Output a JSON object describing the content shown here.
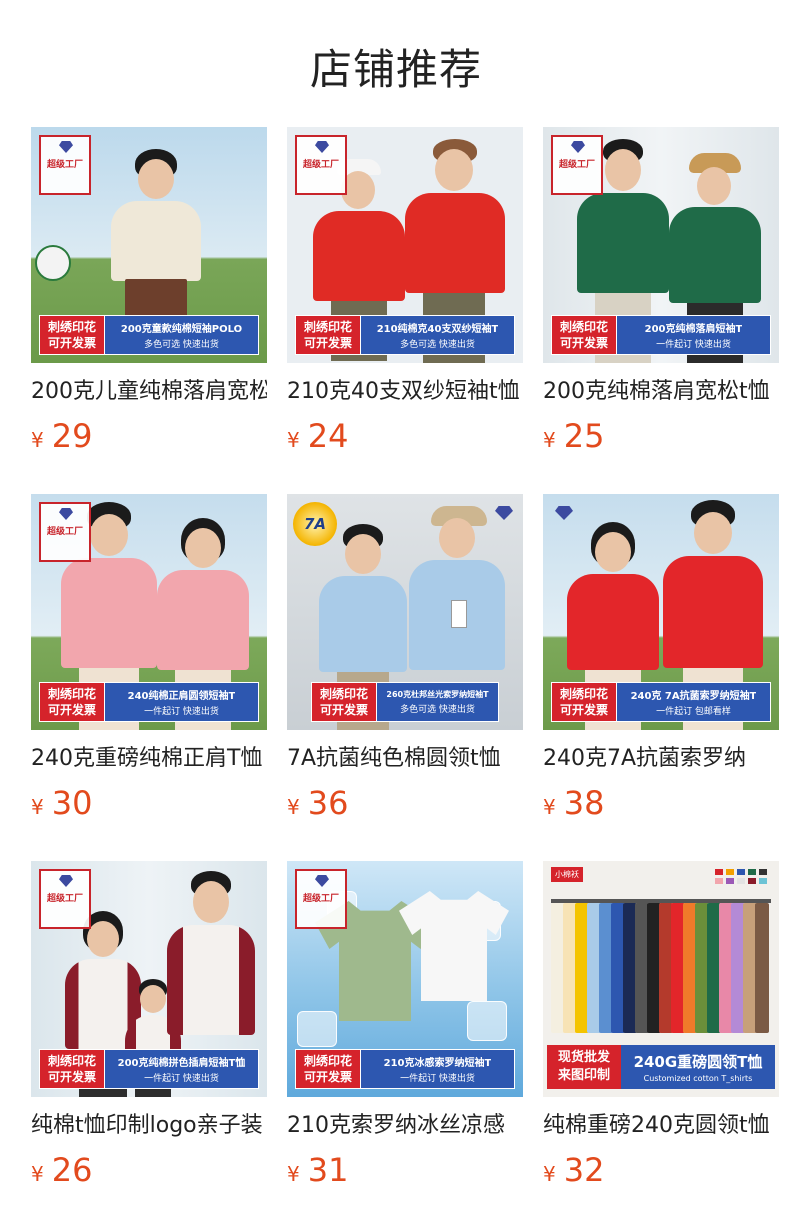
{
  "page": {
    "title": "店铺推荐"
  },
  "products": [
    {
      "name": "200克儿童纯棉落肩宽松",
      "price": "29",
      "currency": "¥",
      "badge": "超级工厂",
      "banner_red_1": "刺绣印花",
      "banner_red_2": "可开发票",
      "banner_line1": "200克童款纯棉短袖POLO",
      "banner_line2": "多色可选 快速出货",
      "bg": "#cfe3ef",
      "ground": "#6b9a49",
      "shirt": "#efe8d8",
      "people": 1
    },
    {
      "name": "210克40支双纱短袖t恤",
      "price": "24",
      "currency": "¥",
      "badge": "超级工厂",
      "banner_red_1": "刺绣印花",
      "banner_red_2": "可开发票",
      "banner_line1": "210纯棉克40支双纱短袖T",
      "banner_line2": "多色可选 快速出货",
      "bg": "#e9eef2",
      "ground": "#e9eef2",
      "shirt": "#e02b25",
      "people": 2
    },
    {
      "name": "200克纯棉落肩宽松t恤",
      "price": "25",
      "currency": "¥",
      "badge": "超级工厂",
      "banner_red_1": "刺绣印花",
      "banner_red_2": "可开发票",
      "banner_line1": "200克纯棉落肩短袖T",
      "banner_line2": "一件起订 快速出货",
      "bg": "#e7ecef",
      "ground": "#d9dde0",
      "shirt": "#1f6b48",
      "people": 2
    },
    {
      "name": "240克重磅纯棉正肩T恤",
      "price": "30",
      "currency": "¥",
      "badge": "超级工厂",
      "banner_red_1": "刺绣印花",
      "banner_red_2": "可开发票",
      "banner_line1": "240纯棉正肩圆领短袖T",
      "banner_line2": "一件起订 快速出货",
      "bg": "#cfe3ef",
      "ground": "#7da95a",
      "shirt": "#f2a6ad",
      "people": 2
    },
    {
      "name": "7A抗菌纯色棉圆领t恤",
      "price": "36",
      "currency": "¥",
      "badge": "",
      "badge_7a": "7A",
      "banner_red_1": "刺绣印花",
      "banner_red_2": "可开发票",
      "banner_line1": "260克杜邦丝光索罗纳短袖T",
      "banner_line2": "多色可选 快速出货",
      "bg": "#d7dde2",
      "ground": "#c9cfd4",
      "shirt": "#a9cbe8",
      "people": 2
    },
    {
      "name": "240克7A抗菌索罗纳",
      "price": "38",
      "currency": "¥",
      "badge": "",
      "banner_red_1": "刺绣印花",
      "banner_red_2": "可开发票",
      "banner_line1": "240克 7A抗菌索罗纳短袖T",
      "banner_line2": "一件起订 包邮看样",
      "bg": "#cfe3ef",
      "ground": "#7da95a",
      "shirt": "#e3262a",
      "people": 2
    },
    {
      "name": "纯棉t恤印制logo亲子装",
      "price": "26",
      "currency": "¥",
      "badge": "超级工厂",
      "banner_red_1": "刺绣印花",
      "banner_red_2": "可开发票",
      "banner_line1": "200克纯棉拼色插肩短袖T恤",
      "banner_line2": "一件起订 快速出货",
      "bg": "#e6eef3",
      "ground": "#d6dde1",
      "shirt": "#f4f1ee",
      "people": 3
    },
    {
      "name": "210克索罗纳冰丝凉感",
      "price": "31",
      "currency": "¥",
      "badge": "超级工厂",
      "banner_red_1": "刺绣印花",
      "banner_red_2": "可开发票",
      "banner_line1": "210克冰感索罗纳短袖T",
      "banner_line2": "一件起订 快速出货",
      "bg": "#cfe7f7",
      "ground": "#5fa9dc",
      "shirt": "#9fb98d",
      "people": 0
    },
    {
      "name": "纯棉重磅240克圆领t恤",
      "price": "32",
      "currency": "¥",
      "brand_tag": "小棉袄",
      "banner_red_1": "现货批发",
      "banner_red_2": "来图印制",
      "banner_line1": "240G重磅圆领T恤",
      "banner_line2": "Customized cotton T_shirts",
      "bg": "#f2f0ec",
      "ground": "#f2f0ec",
      "shirt": "",
      "people": 0
    }
  ],
  "colors": {
    "price": "#e24a1d",
    "banner_red": "#d5232b",
    "banner_blue": "#2d57b0"
  }
}
